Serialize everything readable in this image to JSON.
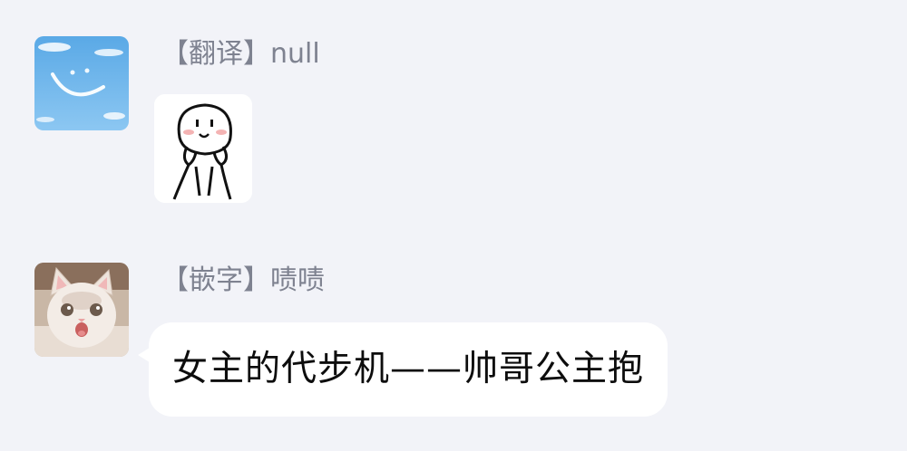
{
  "messages": [
    {
      "avatar_icon": "sky-cloud-avatar-icon",
      "sender_label": "【翻译】null",
      "content_type": "sticker",
      "sticker_icon": "hands-on-cheeks-doodle-sticker-icon"
    },
    {
      "avatar_icon": "surprised-cat-avatar-icon",
      "sender_label": "【嵌字】啧啧",
      "content_type": "text",
      "text": "女主的代步机——帅哥公主抱"
    }
  ],
  "colors": {
    "background": "#f2f3f8",
    "bubble": "#ffffff",
    "sender_text": "#7e8290",
    "message_text": "#0d0d0d"
  }
}
